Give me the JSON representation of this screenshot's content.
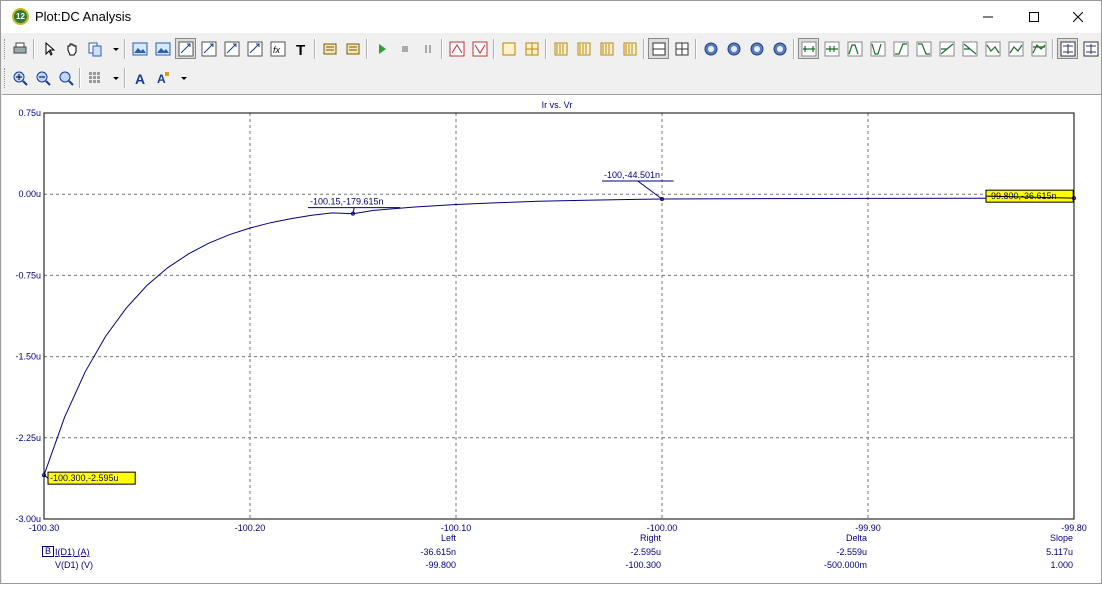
{
  "window": {
    "title": "Plot:DC Analysis",
    "icon_label": "12",
    "controls": [
      "minimize-icon",
      "maximize-icon",
      "close-icon"
    ]
  },
  "toolbar_row1": [
    "print-icon",
    "select-arrow-icon",
    "pan-hand-icon",
    "copy-icon",
    "dropdown-arrow-icon",
    "image-icon",
    "image-frame-icon",
    "auto-scale-icon",
    "scale-icon",
    "scale-y-icon",
    "scale-xy-icon",
    "function-icon",
    "text-tool-icon",
    "properties-icon",
    "settings-icon",
    "run-icon",
    "stop-icon",
    "pause-icon",
    "cursor-peak-icon",
    "cursor-valley-icon",
    "box-icon",
    "grid-box-icon",
    "layout-1-icon",
    "layout-2-icon",
    "layout-3-icon",
    "layout-4-icon",
    "split-h-icon",
    "split-grid-icon",
    "zoom-1-icon",
    "zoom-2-icon",
    "zoom-3-icon",
    "zoom-4-icon",
    "cursor-next-icon",
    "cursor-prev-icon",
    "peak-icon",
    "valley-icon",
    "rise-icon",
    "fall-icon",
    "slope-up-icon",
    "slope-down-icon",
    "low-icon",
    "high-icon",
    "global-high-icon",
    "tag-mode-icon",
    "tag-values-icon"
  ],
  "toolbar_row2": [
    "zoom-in-icon",
    "zoom-out-icon",
    "zoom-fit-icon",
    "grid-icon",
    "dropdown-arrow-icon",
    "font-icon",
    "font-color-icon",
    "dropdown-arrow-icon"
  ],
  "plot": {
    "title": "Ir vs. Vr",
    "background": "#ffffff",
    "curve_color": "#000080",
    "label_color": "#000080",
    "tag_fill": "#ffff00"
  },
  "chart_data": {
    "type": "line",
    "title": "Ir vs. Vr",
    "xlabel": "",
    "ylabel": "",
    "xlim": [
      -100.3,
      -99.8
    ],
    "ylim": [
      -3.0,
      0.75
    ],
    "x_ticks": [
      "-100.30",
      "-100.20",
      "-100.10",
      "-100.00",
      "-99.90",
      "-99.80"
    ],
    "y_ticks": [
      "0.75u",
      "0.00u",
      "-0.75u",
      "-1.50u",
      "-2.25u",
      "-3.00u"
    ],
    "y_tick_values": [
      0.75,
      0.0,
      -0.75,
      -1.5,
      -2.25,
      -3.0
    ],
    "x_tick_values": [
      -100.3,
      -100.2,
      -100.1,
      -100.0,
      -99.9,
      -99.8
    ],
    "grid": true,
    "series": [
      {
        "name": "I(D1) (A)",
        "x": [
          -100.3,
          -100.29,
          -100.28,
          -100.27,
          -100.26,
          -100.25,
          -100.24,
          -100.23,
          -100.22,
          -100.21,
          -100.2,
          -100.19,
          -100.18,
          -100.17,
          -100.16,
          -100.15,
          -100.14,
          -100.12,
          -100.1,
          -100.08,
          -100.06,
          -100.04,
          -100.02,
          -100.0,
          -99.95,
          -99.9,
          -99.85,
          -99.8
        ],
        "y": [
          -2.595,
          -2.06,
          -1.64,
          -1.31,
          -1.05,
          -0.842,
          -0.68,
          -0.553,
          -0.453,
          -0.374,
          -0.312,
          -0.263,
          -0.225,
          -0.195,
          -0.173,
          -0.18,
          -0.15,
          -0.118,
          -0.095,
          -0.079,
          -0.066,
          -0.057,
          -0.05,
          -0.0445,
          -0.041,
          -0.039,
          -0.0375,
          -0.0366
        ]
      }
    ],
    "tags": [
      {
        "text": "-100.15,-179.615n",
        "x": -100.15,
        "y": -0.1796,
        "style": "underline"
      },
      {
        "text": "-100,-44.501n",
        "x": -100.0,
        "y": -0.0445,
        "style": "underline"
      },
      {
        "text": "-99.800,-36.615n",
        "x": -99.8,
        "y": -0.0366,
        "style": "box"
      },
      {
        "text": "-100.300,-2.595u",
        "x": -100.3,
        "y": -2.595,
        "style": "box"
      }
    ]
  },
  "footer": {
    "box_label": "B",
    "series1": "I(D1) (A)",
    "series2": "V(D1) (V)",
    "columns": [
      {
        "header": "Left",
        "v1": "-36.615n",
        "v2": "-99.800"
      },
      {
        "header": "Right",
        "v1": "-2.595u",
        "v2": "-100.300"
      },
      {
        "header": "Delta",
        "v1": "-2.559u",
        "v2": "-500.000m"
      },
      {
        "header": "Slope",
        "v1": "5.117u",
        "v2": "1.000"
      }
    ]
  }
}
